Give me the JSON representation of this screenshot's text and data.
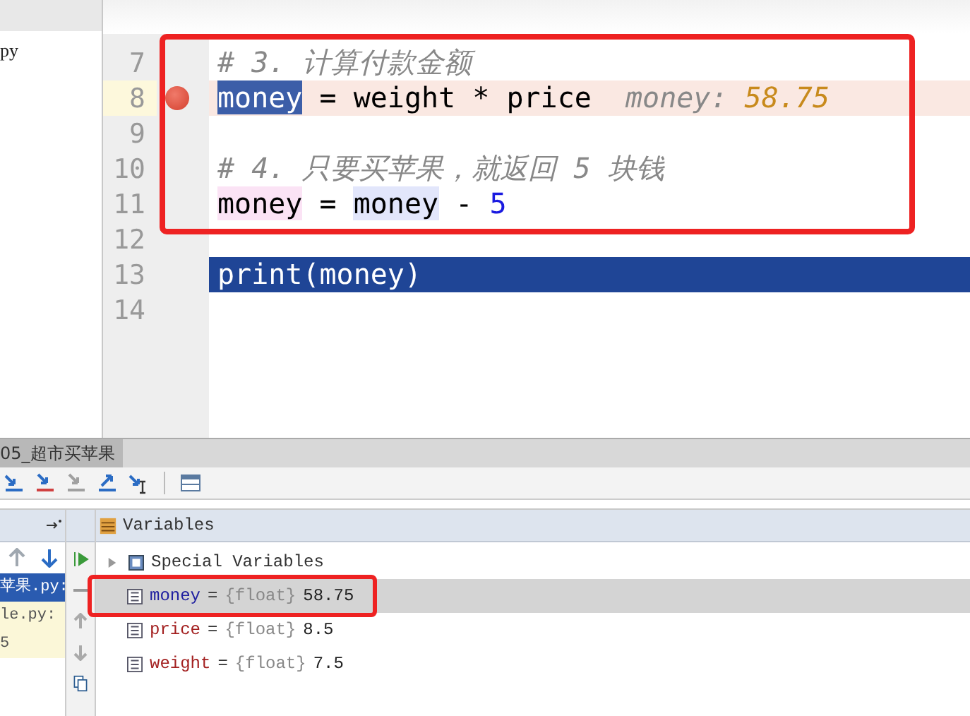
{
  "project_panel": {
    "items": [
      {
        "label": "py",
        "selected": false
      }
    ]
  },
  "editor": {
    "lines": [
      {
        "number": "7",
        "breakpoint": false,
        "current": false,
        "segments": [
          {
            "kind": "comment",
            "text": "# 3. 计算付款金额"
          }
        ]
      },
      {
        "number": "8",
        "breakpoint": true,
        "current": false,
        "segments": [
          {
            "kind": "selected-ident",
            "text": "money"
          },
          {
            "kind": "plain",
            "text": " = weight * price  "
          },
          {
            "kind": "hint-label",
            "text": "money: "
          },
          {
            "kind": "hint-value",
            "text": "58.75"
          }
        ]
      },
      {
        "number": "9",
        "breakpoint": false,
        "current": false
      },
      {
        "number": "10",
        "breakpoint": false,
        "current": false,
        "segments": [
          {
            "kind": "comment",
            "text": "# 4. 只要买苹果，就返回 5 块钱"
          }
        ]
      },
      {
        "number": "11",
        "breakpoint": false,
        "current": false,
        "segments": [
          {
            "kind": "write-ident",
            "text": "money"
          },
          {
            "kind": "plain",
            "text": " = "
          },
          {
            "kind": "read-ident",
            "text": "money"
          },
          {
            "kind": "plain",
            "text": " - "
          },
          {
            "kind": "number",
            "text": "5"
          }
        ]
      },
      {
        "number": "12",
        "breakpoint": false,
        "current": false
      },
      {
        "number": "13",
        "breakpoint": false,
        "current": true,
        "segments": [
          {
            "kind": "plain",
            "text": "print(money)"
          }
        ]
      },
      {
        "number": "14",
        "breakpoint": false,
        "current": false
      }
    ]
  },
  "debug_tab": {
    "label": "05_超市买苹果"
  },
  "frames": [
    {
      "label": "苹果.py:",
      "selected": true
    },
    {
      "label": "le.py:",
      "selected": false
    },
    {
      "label": "5",
      "selected": false
    }
  ],
  "variables_panel": {
    "title": "Variables",
    "items": [
      {
        "kind": "group",
        "name": "Special Variables",
        "selected": false
      },
      {
        "kind": "var",
        "name": "money",
        "separator": "=",
        "type": "{float}",
        "value": "58.75",
        "selected": true
      },
      {
        "kind": "var",
        "name": "price",
        "separator": "=",
        "type": "{float}",
        "value": "8.5",
        "selected": false
      },
      {
        "kind": "var",
        "name": "weight",
        "separator": "=",
        "type": "{float}",
        "value": "7.5",
        "selected": false
      }
    ]
  }
}
